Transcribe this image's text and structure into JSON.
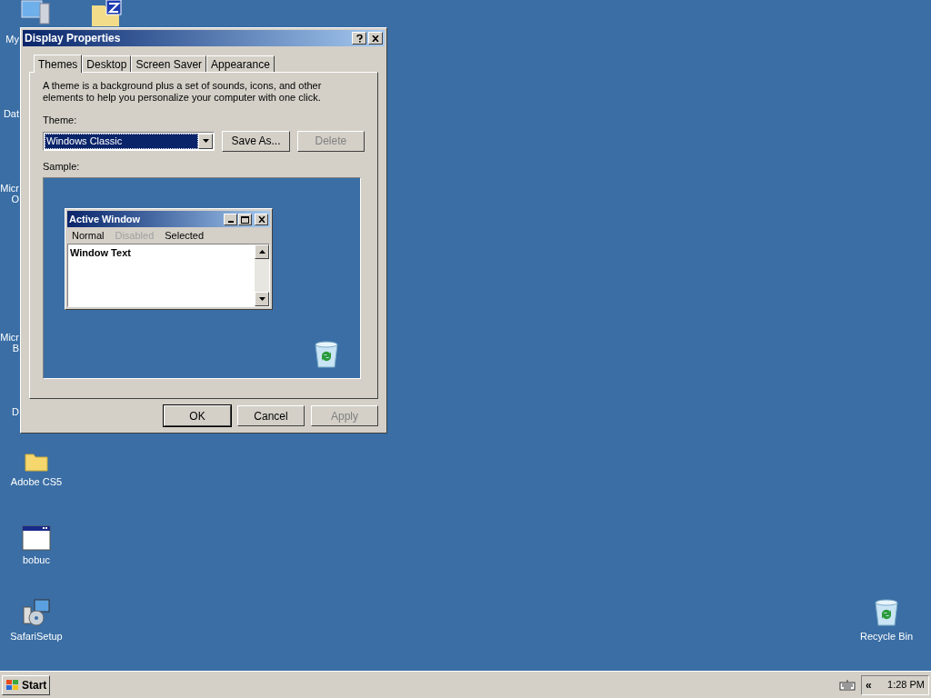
{
  "desktop_icons": [
    {
      "kind": "cut",
      "lines": [
        "My"
      ]
    },
    {
      "kind": "cut",
      "lines": [
        "Dat"
      ]
    },
    {
      "kind": "cut",
      "lines": [
        "Micr",
        "O"
      ]
    },
    {
      "kind": "cut",
      "lines": [
        "Micr",
        "B"
      ]
    },
    {
      "kind": "cut",
      "lines": [
        "D"
      ]
    },
    {
      "kind": "folder",
      "lines": [
        "Adobe CS5"
      ]
    },
    {
      "kind": "app",
      "lines": [
        "bobuc"
      ]
    },
    {
      "kind": "setup",
      "lines": [
        "SafariSetup"
      ]
    },
    {
      "kind": "recycle",
      "lines": [
        "Recycle Bin"
      ]
    }
  ],
  "dialog": {
    "title": "Display Properties",
    "tabs": [
      {
        "label": "Themes",
        "selected": true
      },
      {
        "label": "Desktop",
        "selected": false
      },
      {
        "label": "Screen Saver",
        "selected": false
      },
      {
        "label": "Appearance",
        "selected": false
      }
    ],
    "description": "A theme is a background plus a set of sounds, icons, and other elements to help you personalize your computer with one click.",
    "theme_label": "Theme:",
    "theme_value": "Windows Classic",
    "theme_buttons": [
      {
        "label": "Save As...",
        "disabled": false
      },
      {
        "label": "Delete",
        "disabled": true
      }
    ],
    "sample_label": "Sample:",
    "sample": {
      "title": "Active Window",
      "menu": [
        {
          "label": "Normal",
          "disabled": false
        },
        {
          "label": "Disabled",
          "disabled": true
        },
        {
          "label": "Selected",
          "disabled": false
        }
      ],
      "text": "Window Text"
    },
    "buttons": [
      {
        "label": "OK",
        "disabled": false,
        "default": true
      },
      {
        "label": "Cancel",
        "disabled": false,
        "default": false
      },
      {
        "label": "Apply",
        "disabled": true,
        "default": false
      }
    ]
  },
  "taskbar": {
    "start": "Start",
    "chevron": "«",
    "time": "1:28 PM"
  }
}
